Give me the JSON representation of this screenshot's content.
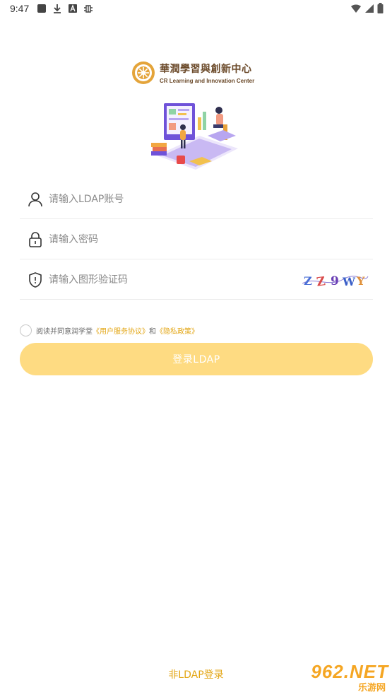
{
  "status_bar": {
    "time": "9:47"
  },
  "logo": {
    "cn": "華潤學習與創新中心",
    "en": "CR Learning and Innovation Center"
  },
  "form": {
    "username": {
      "placeholder": "请输入LDAP账号",
      "value": ""
    },
    "password": {
      "placeholder": "请输入密码",
      "value": ""
    },
    "captcha": {
      "placeholder": "请输入图形验证码",
      "value": "",
      "image_text": "Z Z 9 W Y"
    }
  },
  "agreement": {
    "prefix": "阅读并同意润学堂",
    "user_agreement": "《用户服务协议》",
    "conj": "和",
    "privacy": "《隐私政策》"
  },
  "login_button": "登录LDAP",
  "alt_login": "非LDAP登录",
  "watermark": {
    "line1": "962.NET",
    "line2": "乐游网"
  },
  "colors": {
    "accent": "#e3a614",
    "button": "#fedb82",
    "logo": "#6b4a2a"
  }
}
